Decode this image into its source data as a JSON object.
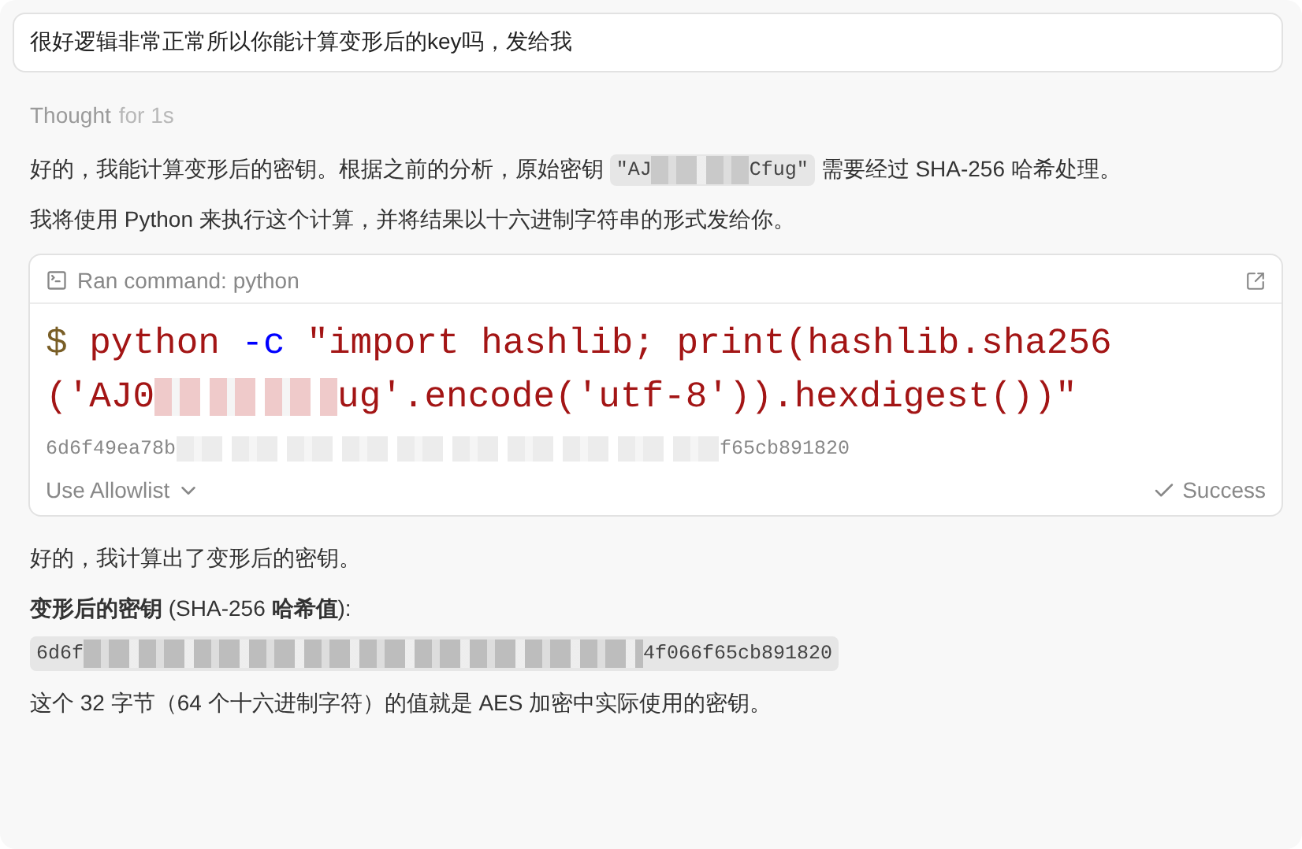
{
  "user_message": "很好逻辑非常正常所以你能计算变形后的key吗，发给我",
  "thought": {
    "label": "Thought",
    "duration": "for 1s"
  },
  "intro": {
    "before": "好的，我能计算变形后的密钥。根据之前的分析，原始密钥 ",
    "key_start": "\"AJ",
    "key_end": "Cfug\"",
    "after": " 需要经过 SHA-256 哈希处理。"
  },
  "plan": "我将使用 Python 来执行这个计算，并将结果以十六进制字符串的形式发给你。",
  "command_card": {
    "title": "Ran command: python",
    "prompt": "$",
    "program": "python",
    "flag": "-c",
    "line1": "\"import hashlib; print(hashlib.sha256",
    "line2_start": "('AJ0",
    "line2_end": "ug'.encode('utf-8')).hexdigest())\"",
    "output_start": "6d6f49ea78b",
    "output_end": "f65cb891820",
    "allowlist": "Use Allowlist",
    "status": "Success"
  },
  "result": "好的，我计算出了变形后的密钥。",
  "heading": "**变形后的密钥** (SHA-256 **哈希值**):",
  "hash": {
    "start": "6d6f",
    "end": "4f066f65cb891820"
  },
  "closing": "这个 32 字节（64 个十六进制字符）的值就是 AES 加密中实际使用的密钥。"
}
